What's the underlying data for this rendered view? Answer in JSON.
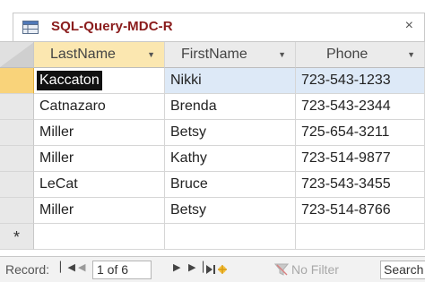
{
  "tab": {
    "title": "SQL-Query-MDC-R",
    "close": "×"
  },
  "columns": [
    {
      "label": "LastName"
    },
    {
      "label": "FirstName"
    },
    {
      "label": "Phone"
    }
  ],
  "rows": [
    {
      "last": "Kaccaton",
      "first": "Nikki",
      "phone": "723-543-1233"
    },
    {
      "last": "Catnazaro",
      "first": "Brenda",
      "phone": "723-543-2344"
    },
    {
      "last": "Miller",
      "first": "Betsy",
      "phone": "725-654-3211"
    },
    {
      "last": "Miller",
      "first": "Kathy",
      "phone": "723-514-9877"
    },
    {
      "last": "LeCat",
      "first": "Bruce",
      "phone": "723-543-3455"
    },
    {
      "last": "Miller",
      "first": "Betsy",
      "phone": "723-514-8766"
    }
  ],
  "new_row_marker": "*",
  "status": {
    "record_label": "Record:",
    "record_value": "1 of 6",
    "nav_first": "◀",
    "nav_prev": "◀",
    "nav_next": "▶",
    "nav_last": "▶",
    "filter_label": "No Filter",
    "search_label": "Search"
  },
  "colors": {
    "title": "#8a1c1c",
    "current_row": "#dde9f7",
    "sorted_header": "#fbe7b0",
    "record_selector": "#f9d37a"
  }
}
